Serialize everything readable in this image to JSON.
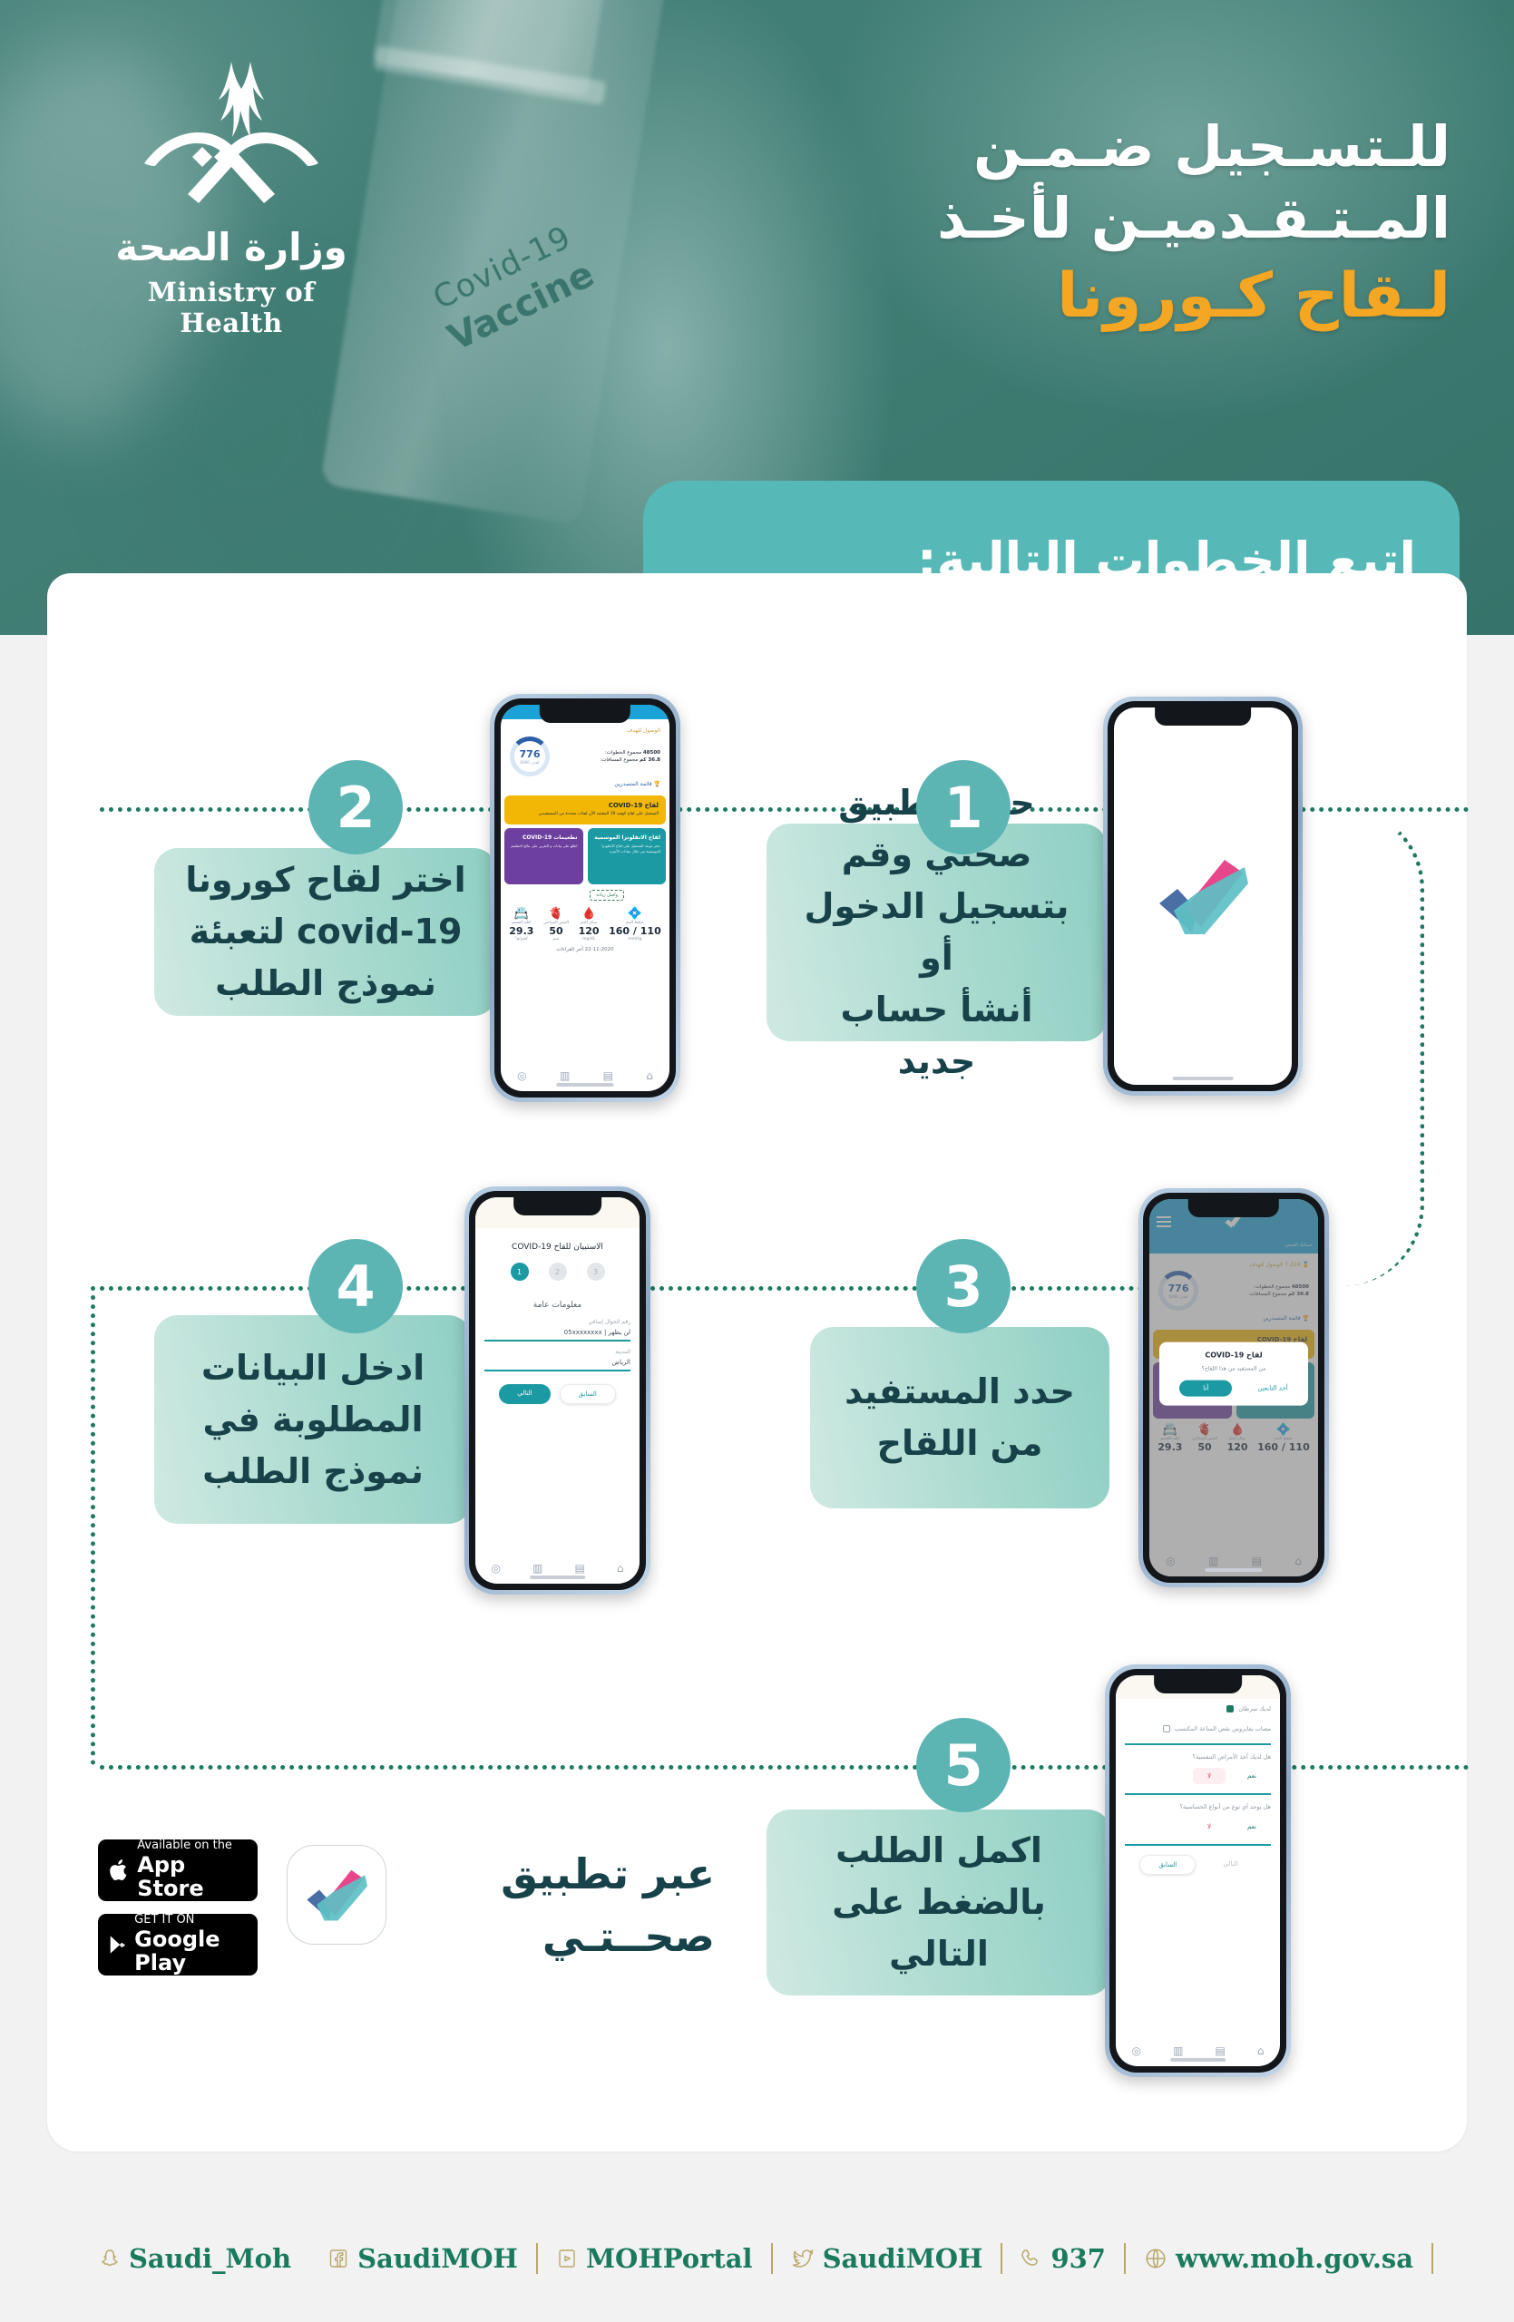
{
  "header": {
    "logo_ar": "وزارة الصحة",
    "logo_en": "Ministry of Health",
    "title_line1": "للـتسـجيل ضـمـن",
    "title_line2": "المـتـقـدميـن لأخـذ",
    "title_line3": "لـقاح كـورونا",
    "banner": "اتبع الخطوات التالية:",
    "vial_l1": "Covid-19",
    "vial_l2": "Vaccine",
    "accent_color": "#F5A623",
    "bg_color": "#3f7d74",
    "banner_color": "#57b9b7"
  },
  "steps": [
    {
      "number": "1",
      "text_plain": "حمل تطبيق صحتي وقم بتسجيل الدخول أو أنشأ حساب جديد",
      "lines": [
        "حمل تطبيق",
        "صحتي وقم",
        "بتسجيل الدخول أو",
        "أنشأ حساب جديد"
      ],
      "bold_word": "صحتي",
      "screen": "sehhaty-splash"
    },
    {
      "number": "2",
      "text_plain": "اختر لقاح كورونا covid-19 لتعبئة نموذج الطلب",
      "lines": [
        "اختر لقاح كورونا",
        "covid-19 لتعبئة",
        "نموذج الطلب"
      ],
      "bold_word": "covid-19",
      "screen": "sehhaty-home"
    },
    {
      "number": "3",
      "text_plain": "حدد المستفيد من اللقاح",
      "lines": [
        "حدد المستفيد",
        "من اللقاح"
      ],
      "screen": "sehhaty-dialog"
    },
    {
      "number": "4",
      "text_plain": "ادخل البيانات المطلوبة في نموذج الطلب",
      "lines": [
        "ادخل البيانات",
        "المطلوبة في",
        "نموذج الطلب"
      ],
      "screen": "sehhaty-form"
    },
    {
      "number": "5",
      "text_plain": "اكمل الطلب بالضغط على التالي",
      "lines": [
        "اكمل الطلب",
        "بالضغط على",
        "التالي"
      ],
      "screen": "sehhaty-questions"
    }
  ],
  "phone_home": {
    "goal_label": "الوصول للهدف",
    "steps_label": "مجموع الخطوات:",
    "steps_value": "48500",
    "distance_label": "مجموع المسافات:",
    "distance_value": "36.8 كم",
    "ring_value": "776",
    "ring_unit": "أهدف 6000",
    "leaderboard": "قائمة المتصدرين",
    "banner_title": "لقاح COVID-19",
    "banner_sub": "التسجيل على لقاح كوفيد 19 المعتمد الآن لفئات محددة من المستفيدين",
    "tile_purple_title": "تطعيمات COVID-19",
    "tile_purple_sub": "اطلع على بيانات و التقرير على نتائج التطعيم",
    "tile_teal_title": "لقاح الانفلونزا الموسمية",
    "tile_teal_sub": "حجز موعد التسجيل على لقاح الانفلونزا الموسمية من خلال عيادات الأسرة",
    "stamp": "واصل زيادة",
    "vitals": [
      {
        "label": "ضغط الدم",
        "value": "110 / 160",
        "unit": "mmHg"
      },
      {
        "label": "سكر الدم",
        "value": "120",
        "unit": "mg/dL"
      },
      {
        "label": "النبض الصباحي",
        "value": "50",
        "unit": "سم"
      },
      {
        "label": "كتلة الجسم",
        "value": "29.3",
        "unit": "كجم/م²"
      }
    ],
    "last_update_label": "آخر القراءات",
    "last_update_value": "22-11-2020",
    "app_name": "صحتي",
    "account_label": "حسابك الصحي",
    "goal_points": "7.224",
    "goal_points_label": "الوصول للهدف"
  },
  "phone_dialog": {
    "title": "لقاح COVID-19",
    "question": "من المستفيد من هذا اللقاح؟",
    "primary_button": "أنا",
    "secondary_button": "أحد التابعين"
  },
  "phone_form": {
    "title": "الاستبيان للقاح COVID-19",
    "step_numbers": [
      "3",
      "2",
      "1"
    ],
    "active_step": "1",
    "section": "معلومات عامة",
    "fields": [
      {
        "label": "رقم الجوال إضافي",
        "value": "05xxxxxxxx",
        "suffix": "لن يظهر"
      },
      {
        "label": "المدينة",
        "value": "الرياض"
      }
    ],
    "next_button": "التالي",
    "prev_button": "السابق"
  },
  "phone_questions": {
    "checkbox_1": "لديك سرطان",
    "checkbox_2": "مصاب بفايروس نقص المناعة المكتسب",
    "questions": [
      {
        "text": "هل لديك أخذ الأمراض التنفسية؟",
        "options": [
          "نعم",
          "لا"
        ],
        "selected": "لا"
      },
      {
        "text": "هل يوجد أي نوع من أنواع الحساسية؟",
        "options": [
          "نعم",
          "لا"
        ],
        "selected": ""
      }
    ],
    "prev_button": "السابق",
    "next_button": "التالي"
  },
  "store": {
    "text_line1": "عبر تطبيق",
    "text_line2": "صحــتـي",
    "appstore_small": "Available on the",
    "appstore_big": "App Store",
    "googleplay_small": "GET IT ON",
    "googleplay_big": "Google Play"
  },
  "footer": {
    "items": [
      {
        "icon": "globe-icon",
        "label": "www.moh.gov.sa"
      },
      {
        "icon": "phone-icon",
        "label": "937"
      },
      {
        "icon": "twitter-icon",
        "label": "SaudiMOH"
      },
      {
        "icon": "youtube-icon",
        "label": "MOHPortal"
      },
      {
        "icon": "facebook-icon",
        "label": "SaudiMOH"
      },
      {
        "icon": "snapchat-icon",
        "label": "Saudi_Moh"
      }
    ],
    "text_color": "#1a7a5e",
    "icon_color": "#b9a86a"
  }
}
